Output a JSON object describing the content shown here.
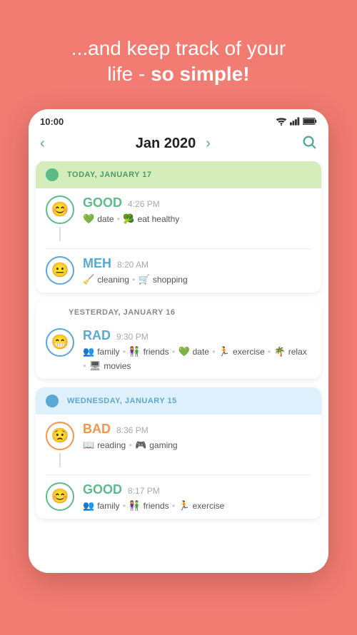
{
  "header": {
    "line1": "...and keep track of your",
    "line2": "life - ",
    "line2bold": "so simple!"
  },
  "statusBar": {
    "time": "10:00"
  },
  "navigation": {
    "month": "Jan 2020",
    "prevArrow": "‹",
    "nextArrow": "›"
  },
  "days": [
    {
      "id": "today",
      "label": "TODAY, JANUARY 17",
      "type": "today",
      "entries": [
        {
          "mood": "GOOD",
          "moodClass": "good",
          "time": "4:26 PM",
          "tags": [
            {
              "icon": "💚",
              "label": "date"
            },
            {
              "icon": "🥦",
              "label": "eat healthy"
            }
          ]
        },
        {
          "mood": "MEH",
          "moodClass": "meh",
          "time": "8:20 AM",
          "tags": [
            {
              "icon": "🧹",
              "label": "cleaning"
            },
            {
              "icon": "🛒",
              "label": "shopping"
            }
          ],
          "last": true
        }
      ]
    },
    {
      "id": "yesterday",
      "label": "YESTERDAY, JANUARY 16",
      "type": "yesterday",
      "entries": [
        {
          "mood": "RAD",
          "moodClass": "rad",
          "time": "9:30 PM",
          "tags": [
            {
              "icon": "👥",
              "label": "family"
            },
            {
              "icon": "👫",
              "label": "friends"
            },
            {
              "icon": "💚",
              "label": "date"
            },
            {
              "icon": "🏃",
              "label": "exercise"
            },
            {
              "icon": "🌴",
              "label": "relax"
            },
            {
              "icon": "🖥",
              "label": "movies"
            }
          ],
          "last": true
        }
      ]
    },
    {
      "id": "wednesday",
      "label": "WEDNESDAY, JANUARY 15",
      "type": "wednesday",
      "entries": [
        {
          "mood": "BAD",
          "moodClass": "bad",
          "time": "8:36 PM",
          "tags": [
            {
              "icon": "📖",
              "label": "reading"
            },
            {
              "icon": "🎮",
              "label": "gaming"
            }
          ]
        },
        {
          "mood": "GOOD",
          "moodClass": "good",
          "time": "8:17 PM",
          "tags": [
            {
              "icon": "👥",
              "label": "family"
            },
            {
              "icon": "👫",
              "label": "friends"
            },
            {
              "icon": "🏃",
              "label": "exercise"
            }
          ],
          "last": true
        }
      ]
    }
  ]
}
